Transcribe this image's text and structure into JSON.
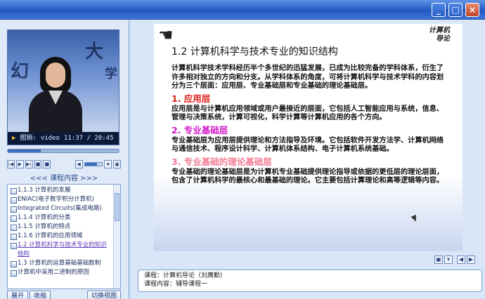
{
  "window": {
    "buttons": {
      "minimize": "_",
      "maximize": "□",
      "close": "×"
    }
  },
  "video": {
    "overlay_chars": [
      "幻",
      "大",
      "学"
    ],
    "play_icon": "▶",
    "label": "图销:",
    "source": "video",
    "time": "11:37 / 20:45",
    "progress": 0.3
  },
  "controls": {
    "left": [
      "|◀",
      "▶",
      "▶|",
      "■",
      "■"
    ],
    "right": [
      "◀",
      "★",
      "▣"
    ],
    "volume": 0.7
  },
  "toc": {
    "header": "<<< 课程内容 >>>",
    "items": [
      {
        "label": "1.1.3 计算机的发展"
      },
      {
        "label": "ENIAC(电子数字积分计算机)"
      },
      {
        "label": "Integrated Circuits(集成电路)"
      },
      {
        "label": "1.1.4 计算机的分类"
      },
      {
        "label": "1.1.5 计算机的特点"
      },
      {
        "label": "1.1.6 计算机的应用领域"
      },
      {
        "label": "1.2 计算机科学与技术专业的知识结构",
        "active": true
      },
      {
        "label": "1.3 计算机的运算基础基础数制"
      },
      {
        "label": "计算机中采用二进制的原因"
      }
    ]
  },
  "bottom_buttons": {
    "expand": "展开",
    "collapse": "收缩",
    "switch_view": "切换视图"
  },
  "slide": {
    "logo_line1": "计算机",
    "logo_line2": "导论",
    "title": "1.2 计算机科学与技术专业的知识结构",
    "intro": "计算机科学技术学科经历半个多世纪的迅猛发展，已成为比较完备的学科体系，衍生了许多相对独立的方向和分支。从学科体系的角度，可将计算机科学与技术学科的内容划分为三个层面：应用层、专业基础层和专业基础的理论基础层。",
    "sections": [
      {
        "heading": "1. 应用层",
        "text": "应用层是与计算机应用领域或用户最接近的层面，它包括人工智能应用与系统，信息、管理与决策系统，计算可视化，科学计算等计算机应用的各个方向。"
      },
      {
        "heading": "2. 专业基础层",
        "text": "专业基础层为应用层提供理论和方法指导及环境。它包括软件开发方法学、计算机网络与通信技术、程序设计科学、计算机体系结构、电子计算机系统基础。"
      },
      {
        "heading": "3. 专业基础的理论基础层",
        "text": "专业基础的理论基础层是为计算机专业基础提供理论指导或依据的更低层的理论层面，包含了计算机科学的最核心和最基础的理论。它主要包括计算理论和高等逻辑等内容。"
      }
    ]
  },
  "info": {
    "course": "课程：计算机导论（刘膺勤）",
    "content": "课程内容：辅导课程一"
  },
  "colors": {
    "accent": "#2d63c8",
    "red": "#e0201b",
    "magenta": "#d117c9",
    "pink": "#f07b93"
  }
}
